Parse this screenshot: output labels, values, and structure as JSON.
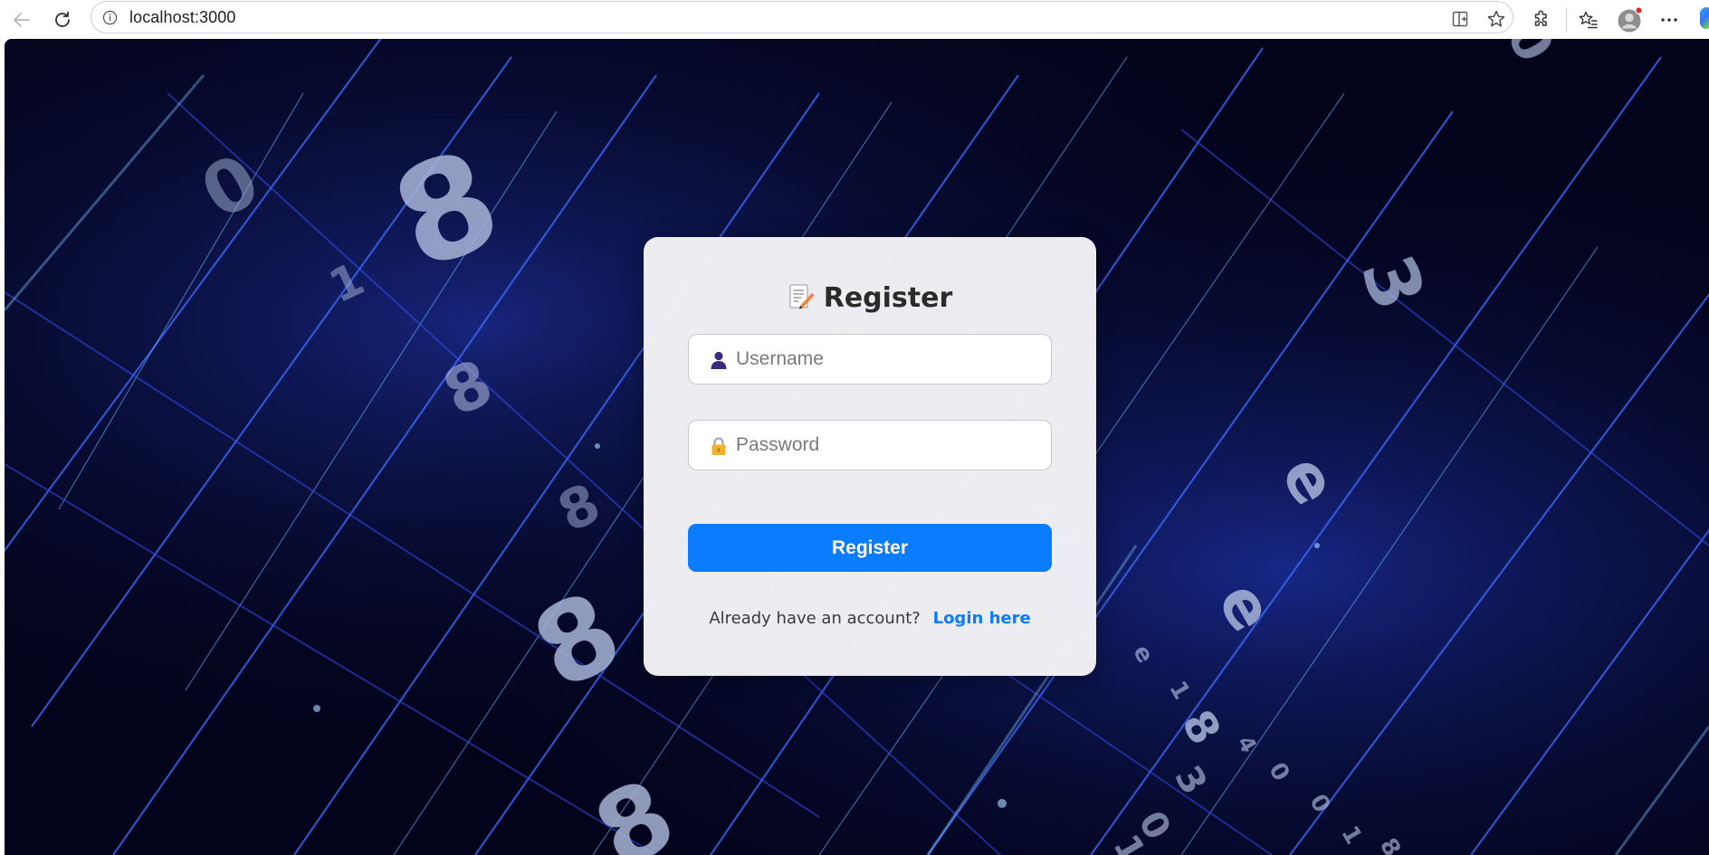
{
  "browser": {
    "url": "localhost:3000",
    "icons": [
      "back-icon",
      "reload-icon",
      "info-icon",
      "split-screen-icon",
      "favorite-star-icon",
      "extensions-icon",
      "favorites-list-icon",
      "profile-avatar-icon",
      "more-options-icon"
    ]
  },
  "register": {
    "title": "Register",
    "title_icon": "memo-icon",
    "username": {
      "placeholder": "Username",
      "value": "",
      "icon": "user-icon"
    },
    "password": {
      "placeholder": "Password",
      "value": "",
      "icon": "lock-icon"
    },
    "submit_label": "Register",
    "prompt_text": "Already have an account?",
    "login_link_text": "Login here"
  },
  "colors": {
    "primary": "#0a7cff",
    "background": "#020318",
    "card": "#f4f4f7"
  }
}
